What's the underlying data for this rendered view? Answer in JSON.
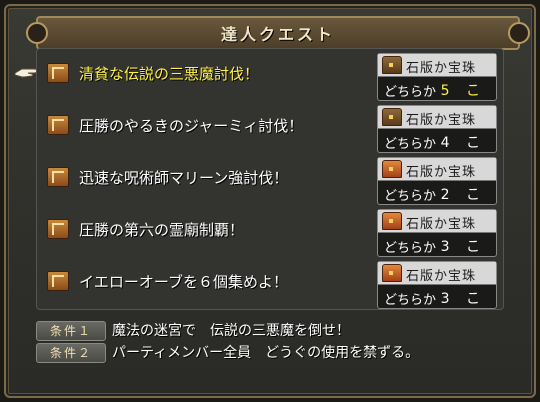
{
  "title": "達人クエスト",
  "quests": [
    {
      "name": "清貧な伝説の三悪魔討伐！",
      "reward_item": "石版か宝珠",
      "reward_prefix": "どちらか",
      "reward_count": "5 こ",
      "chest": "dark",
      "active": true
    },
    {
      "name": "圧勝のやるきのジャーミィ討伐！",
      "reward_item": "石版か宝珠",
      "reward_prefix": "どちらか",
      "reward_count": "4 こ",
      "chest": "dark",
      "active": false
    },
    {
      "name": "迅速な呪術師マリーン強討伐！",
      "reward_item": "石版か宝珠",
      "reward_prefix": "どちらか",
      "reward_count": "2 こ",
      "chest": "red",
      "active": false
    },
    {
      "name": "圧勝の第六の霊廟制覇！",
      "reward_item": "石版か宝珠",
      "reward_prefix": "どちらか",
      "reward_count": "3 こ",
      "chest": "red",
      "active": false
    },
    {
      "name": "イエローオーブを６個集めよ！",
      "reward_item": "石版か宝珠",
      "reward_prefix": "どちらか",
      "reward_count": "3 こ",
      "chest": "red",
      "active": false
    }
  ],
  "conditions": [
    {
      "label": "条件１",
      "text": "魔法の迷宮で　伝説の三悪魔を倒せ！"
    },
    {
      "label": "条件２",
      "text": "パーティメンバー全員　どうぐの使用を禁ずる。"
    }
  ],
  "icons": {
    "cursor": "pointing-hand-icon",
    "quest": "scroll-book-icon",
    "reward": "treasure-chest-icon"
  },
  "colors": {
    "active_text": "#fff24a",
    "normal_text": "#ffffff",
    "reward_header_bg": "#d8d8d8"
  }
}
